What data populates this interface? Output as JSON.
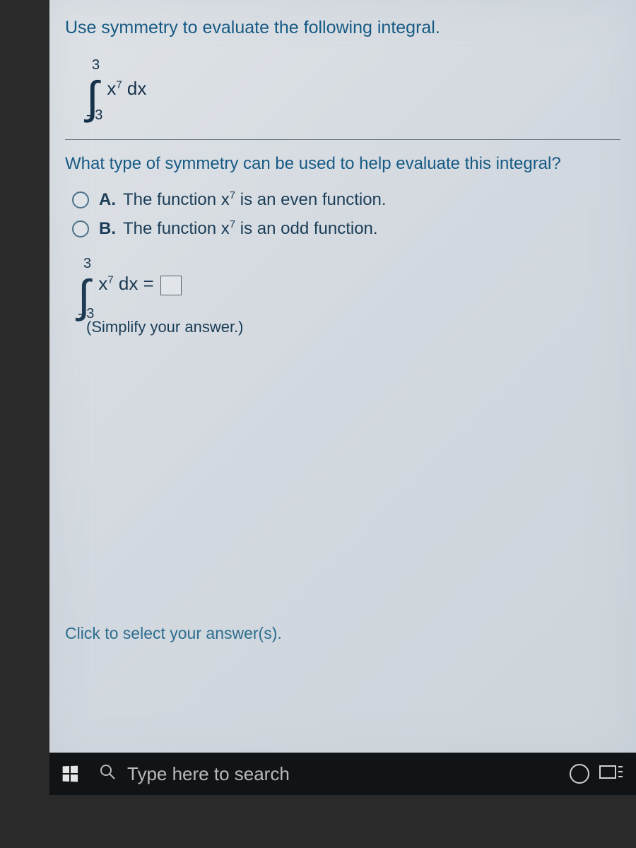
{
  "problem": {
    "instruction": "Use symmetry to evaluate the following integral.",
    "integral": {
      "upper": "3",
      "lower": "- 3",
      "var": "x",
      "exp": "7",
      "dx": "dx"
    }
  },
  "question": "What type of symmetry can be used to help evaluate this integral?",
  "choices": {
    "a": {
      "label": "A.",
      "pre": "The function x",
      "exp": "7",
      "post": " is an even function."
    },
    "b": {
      "label": "B.",
      "pre": "The function x",
      "exp": "7",
      "post": " is an odd function."
    }
  },
  "answer_line": {
    "upper": "3",
    "lower": "- 3",
    "var": "x",
    "exp": "7",
    "dx": "dx =",
    "hint": "(Simplify your answer.)"
  },
  "footer_note": "Click to select your answer(s).",
  "taskbar": {
    "search_placeholder": "Type here to search"
  }
}
